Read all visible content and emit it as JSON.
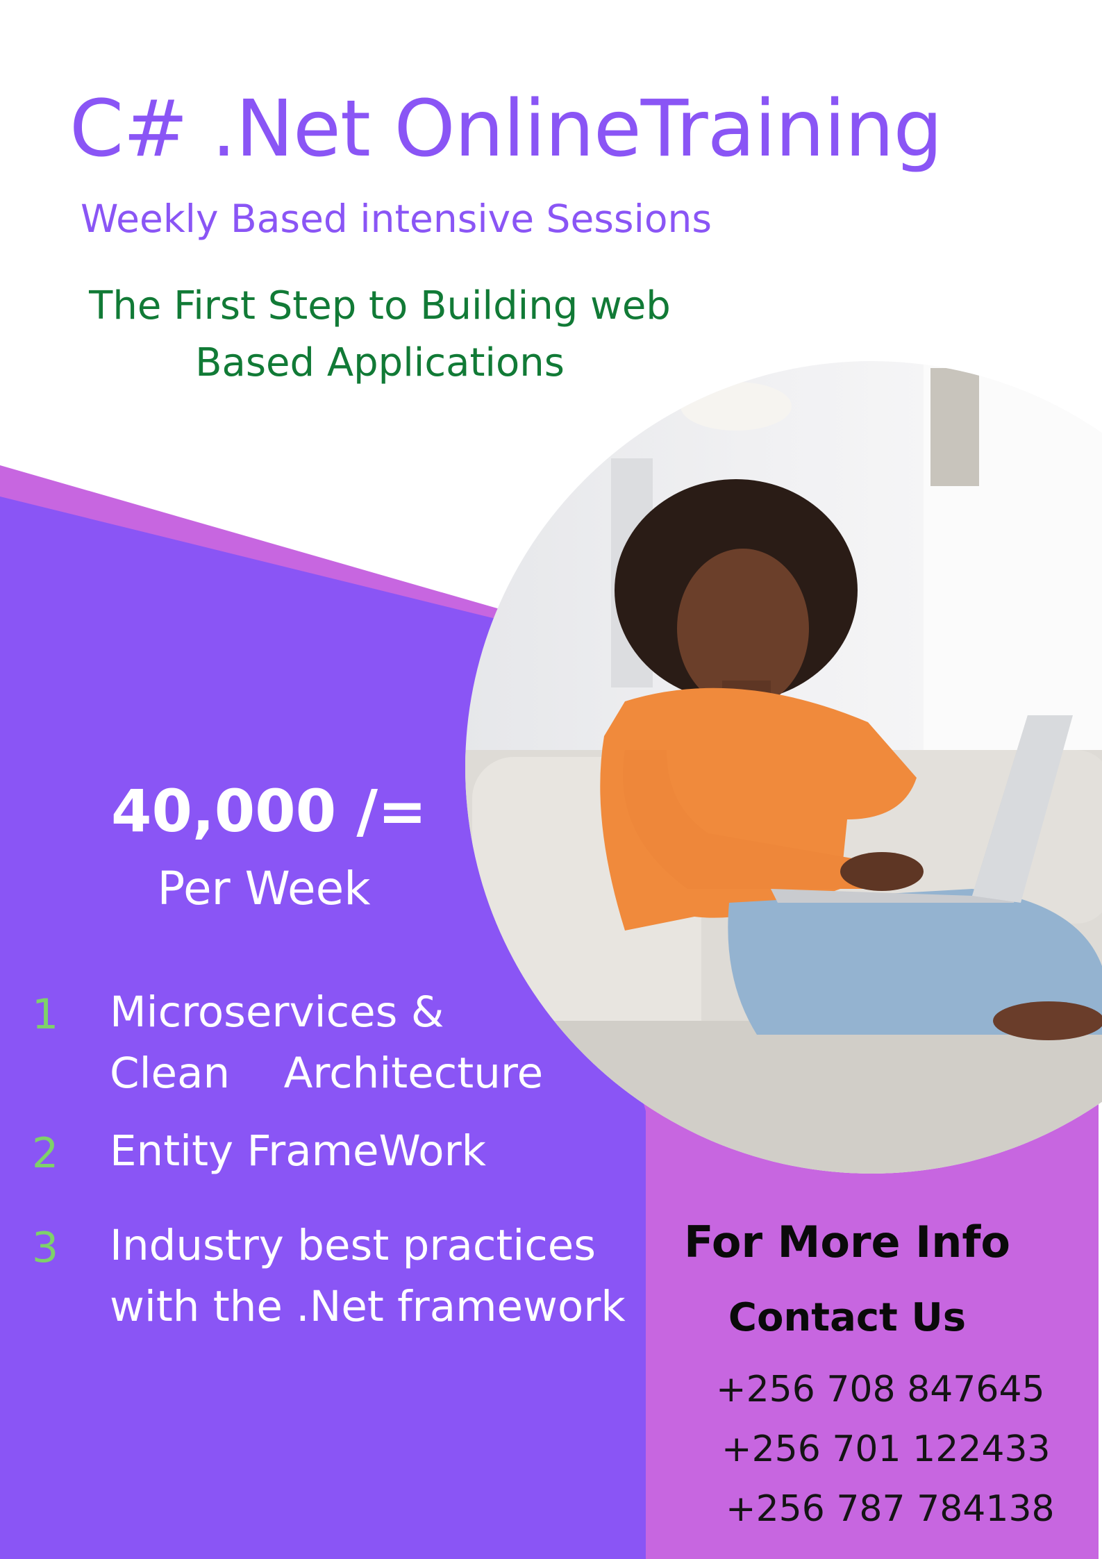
{
  "colors": {
    "accent_purple": "#8a55f5",
    "light_purple": "#c766e0",
    "green_text": "#117a36",
    "number_green": "#7ed16a",
    "white": "#ffffff",
    "black": "#0a0a0a"
  },
  "header": {
    "title": "C# .Net OnlineTraining",
    "subtitle": "Weekly Based intensive Sessions",
    "tagline_line1": "The First Step to Building web",
    "tagline_line2": "Based Applications"
  },
  "photo": {
    "icon": "woman-with-laptop-photo"
  },
  "pricing": {
    "amount": "40,000 /=",
    "period": "Per Week"
  },
  "features": [
    {
      "number": "1",
      "line1": "Microservices &",
      "line2": "Clean    Architecture"
    },
    {
      "number": "2",
      "line1": "Entity FrameWork"
    },
    {
      "number": "3",
      "line1": "Industry best practices",
      "line2": "with the .Net framework"
    }
  ],
  "contact": {
    "heading": "For More Info",
    "subheading": "Contact Us",
    "phones": [
      "+256 708 847645",
      "+256 701 122433",
      "+256 787 784138"
    ]
  }
}
